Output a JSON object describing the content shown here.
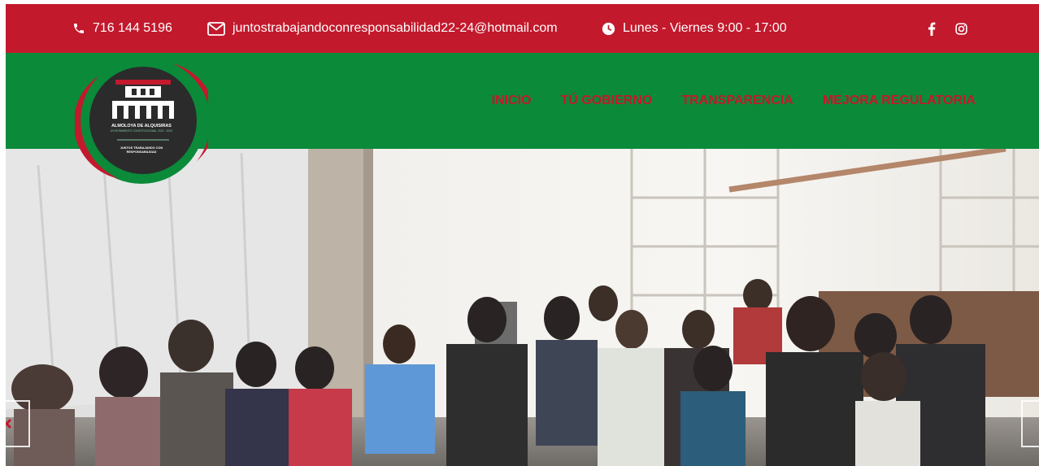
{
  "topbar": {
    "phone": "716 144 5196",
    "email": "juntostrabajandoconresponsabilidad22-24@hotmail.com",
    "hours": "Lunes - Viernes 9:00 - 17:00",
    "icons": [
      "phone-icon",
      "envelope-icon",
      "clock-icon",
      "facebook-icon",
      "instagram-icon"
    ]
  },
  "logo": {
    "name": "ALMOLOYA DE ALQUISIRAS",
    "subtitle": "AYUNTAMIENTO CONSTITUCIONAL 2022 - 2024",
    "motto": "JUNTOS TRABAJANDO CON RESPONSABILIDAD"
  },
  "nav": {
    "items": [
      "INICIO",
      "TÚ GOBIERNO",
      "TRANSPARENCIA",
      "MEJORA REGULATORIA"
    ]
  },
  "colors": {
    "topbar": "#c3192c",
    "header": "#0b8a3a",
    "nav_text": "#c3192c",
    "logo_dark": "#2b2b2b"
  }
}
